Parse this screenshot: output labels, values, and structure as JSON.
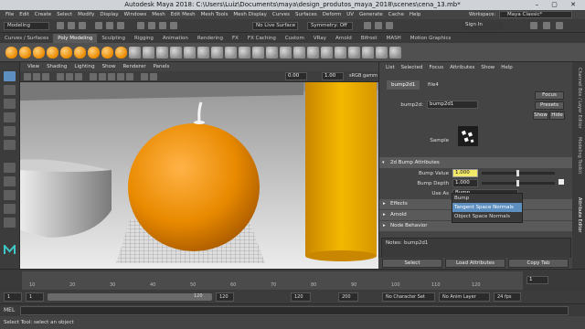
{
  "window": {
    "title": "Autodesk Maya 2018: C:\\Users\\Luiz\\Documents\\maya\\design_produtos_maya_2018\\scenes\\cena_13.mb*",
    "tab_title": "bump2d1",
    "controls": "– ▢ ✕"
  },
  "menubar": {
    "items": [
      "File",
      "Edit",
      "Create",
      "Select",
      "Modify",
      "Display",
      "Windows",
      "Mesh",
      "Edit Mesh",
      "Mesh Tools",
      "Mesh Display",
      "Curves",
      "Surfaces",
      "Deform",
      "UV",
      "Generate",
      "Cache",
      "Help"
    ],
    "workspace_label": "Workspace:",
    "workspace_value": "Maya Classic*"
  },
  "status": {
    "mode": "Modeling",
    "live_surface": "No Live Surface",
    "symmetry": "Symmetry: Off",
    "sign_in": "Sign In"
  },
  "shelf": {
    "tabs": [
      "Curves / Surfaces",
      "Poly Modeling",
      "Sculpting",
      "Rigging",
      "Animation",
      "Rendering",
      "FX",
      "FX Caching",
      "Custom",
      "VRay",
      "Arnold",
      "Bifrost",
      "MASH",
      "Motion Graphics"
    ],
    "active_tab": "Poly Modeling"
  },
  "viewport": {
    "menu": [
      "View",
      "Shading",
      "Lighting",
      "Show",
      "Renderer",
      "Panels"
    ],
    "gamma": "sRGB gamm",
    "field1": "0.00",
    "field2": "1.00"
  },
  "attribute_editor": {
    "menu": [
      "List",
      "Selected",
      "Focus",
      "Attributes",
      "Show",
      "Help"
    ],
    "tabs": [
      "bump2d1",
      "file4"
    ],
    "node_label": "bump2d:",
    "node_value": "bump2d1",
    "focus": "Focus",
    "presets": "Presets",
    "show": "Show",
    "hide": "Hide",
    "sample_label": "Sample",
    "section": "2d Bump Attributes",
    "bump_value_label": "Bump Value",
    "bump_value": "1.000",
    "bump_depth_label": "Bump Depth",
    "bump_depth": "1.000",
    "use_as_label": "Use As",
    "use_as_value": "Bump",
    "use_as_options": [
      "Bump",
      "Tangent Space Normals",
      "Object Space Normals"
    ],
    "collapsed": [
      "Effects",
      "Arnold",
      "Node Behavior"
    ],
    "notes_label": "Notes:",
    "notes_value": "bump2d1",
    "buttons": [
      "Select",
      "Load Attributes",
      "Copy Tab"
    ]
  },
  "side_tabs": [
    "Channel Box / Layer Editor",
    "Modeling Toolkit",
    "Attribute Editor"
  ],
  "timeline": {
    "ticks": [
      "10",
      "20",
      "30",
      "40",
      "50",
      "60",
      "70",
      "80",
      "90",
      "100",
      "110",
      "120"
    ],
    "current_frame": "1"
  },
  "range": {
    "start": "1",
    "start2": "1",
    "range_val": "120",
    "end": "120",
    "end2": "120",
    "end3": "200",
    "char_set": "No Character Set",
    "anim_layer": "No Anim Layer",
    "fps": "24 fps"
  },
  "mel": {
    "label": "MEL"
  },
  "help_line": "Select Tool: select an object",
  "colors": {
    "accent": "#5d8fc0",
    "orange": "#e98a00",
    "yellow": "#f0b400"
  }
}
